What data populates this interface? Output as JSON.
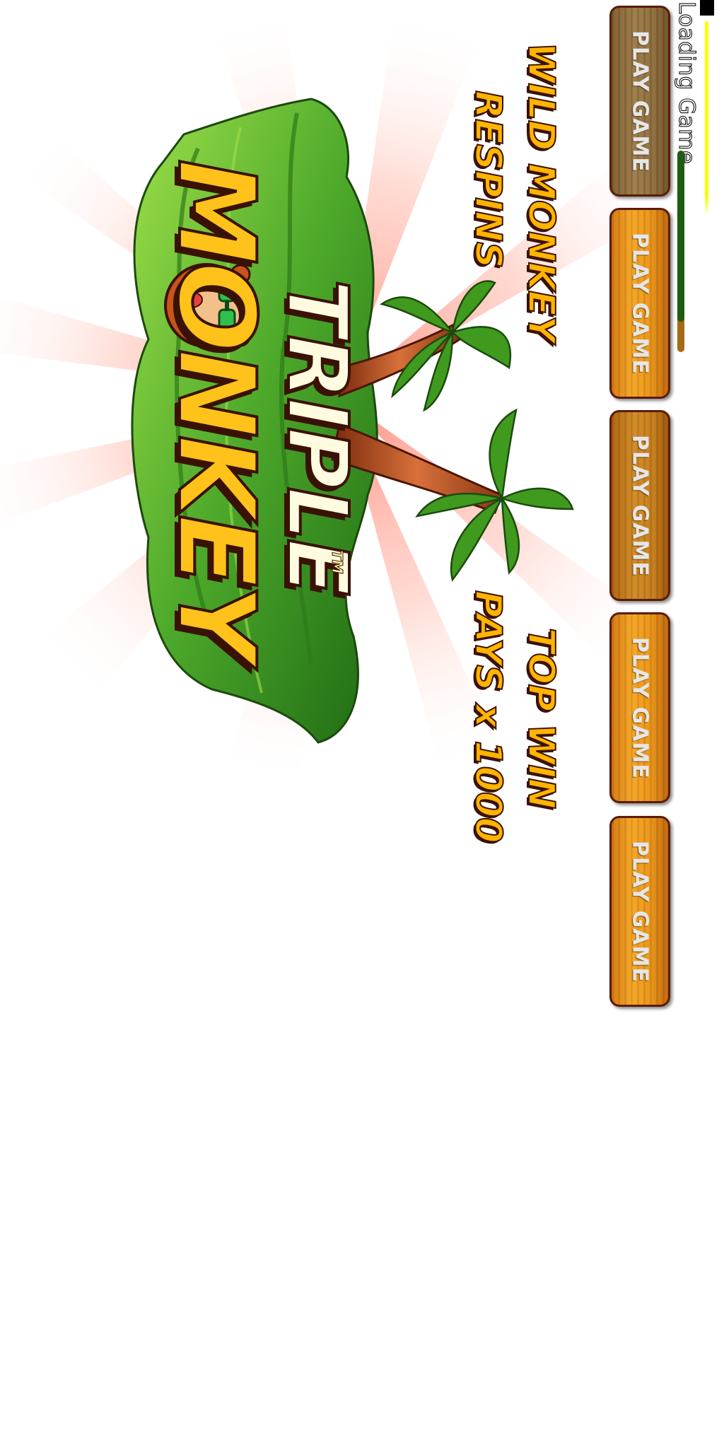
{
  "loading": {
    "text": "Loading Game...",
    "progress": 0.85
  },
  "promos": {
    "wild_line1": "WILD MONKEY",
    "wild_line2": "RESPINS",
    "topwin_line1": "TOP WIN",
    "topwin_line2": "PAYS x 1000"
  },
  "logo": {
    "word1": "TRIPLE",
    "word2": "MONKEY",
    "trademark": "TM"
  },
  "buttons": [
    {
      "label": "PLAY GAME"
    },
    {
      "label": "PLAY GAME"
    },
    {
      "label": "PLAY GAME"
    },
    {
      "label": "PLAY GAME"
    },
    {
      "label": "PLAY GAME"
    }
  ],
  "colors": {
    "button_orange": "#e79116",
    "button_border": "#5a1c06",
    "progress_green": "#1d5c12",
    "loading_yellow": "#ffff00",
    "logo_outline": "#3a1205",
    "jungle_green": "#4ca82a"
  },
  "icons": [
    "monkey-face-icon",
    "palm-tree-icon",
    "jungle-leaves-icon",
    "sun-rays-icon"
  ]
}
